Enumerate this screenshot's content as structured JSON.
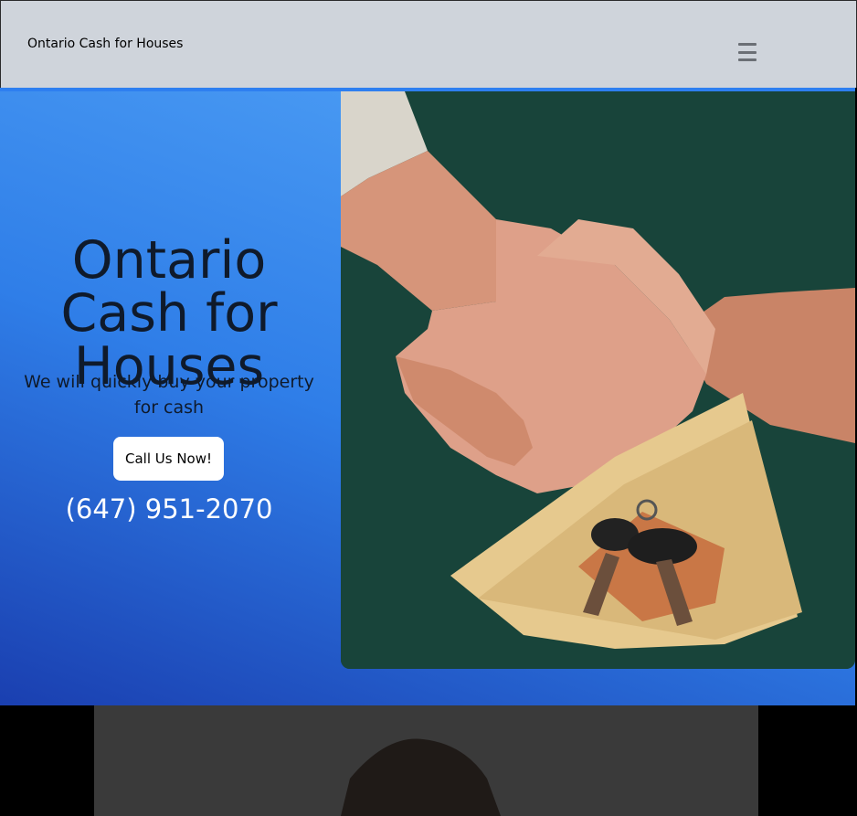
{
  "navbar": {
    "brand": "Ontario Cash for Houses",
    "menu_icon": "hamburger-menu-icon"
  },
  "hero": {
    "title": "Ontario Cash for Houses",
    "subtitle": "We will quickly buy your property for cash",
    "cta_label": "Call Us Now!",
    "phone": "(647) 951-2070",
    "image": "handshake-cash-keys-photo"
  },
  "section2": {
    "image": "person-portrait-photo"
  },
  "colors": {
    "navbar_bg": "#cfd4db",
    "hero_gradient_start": "#1a3fb0",
    "hero_gradient_end": "#55a7f8",
    "photo_bg": "#1a4535"
  }
}
